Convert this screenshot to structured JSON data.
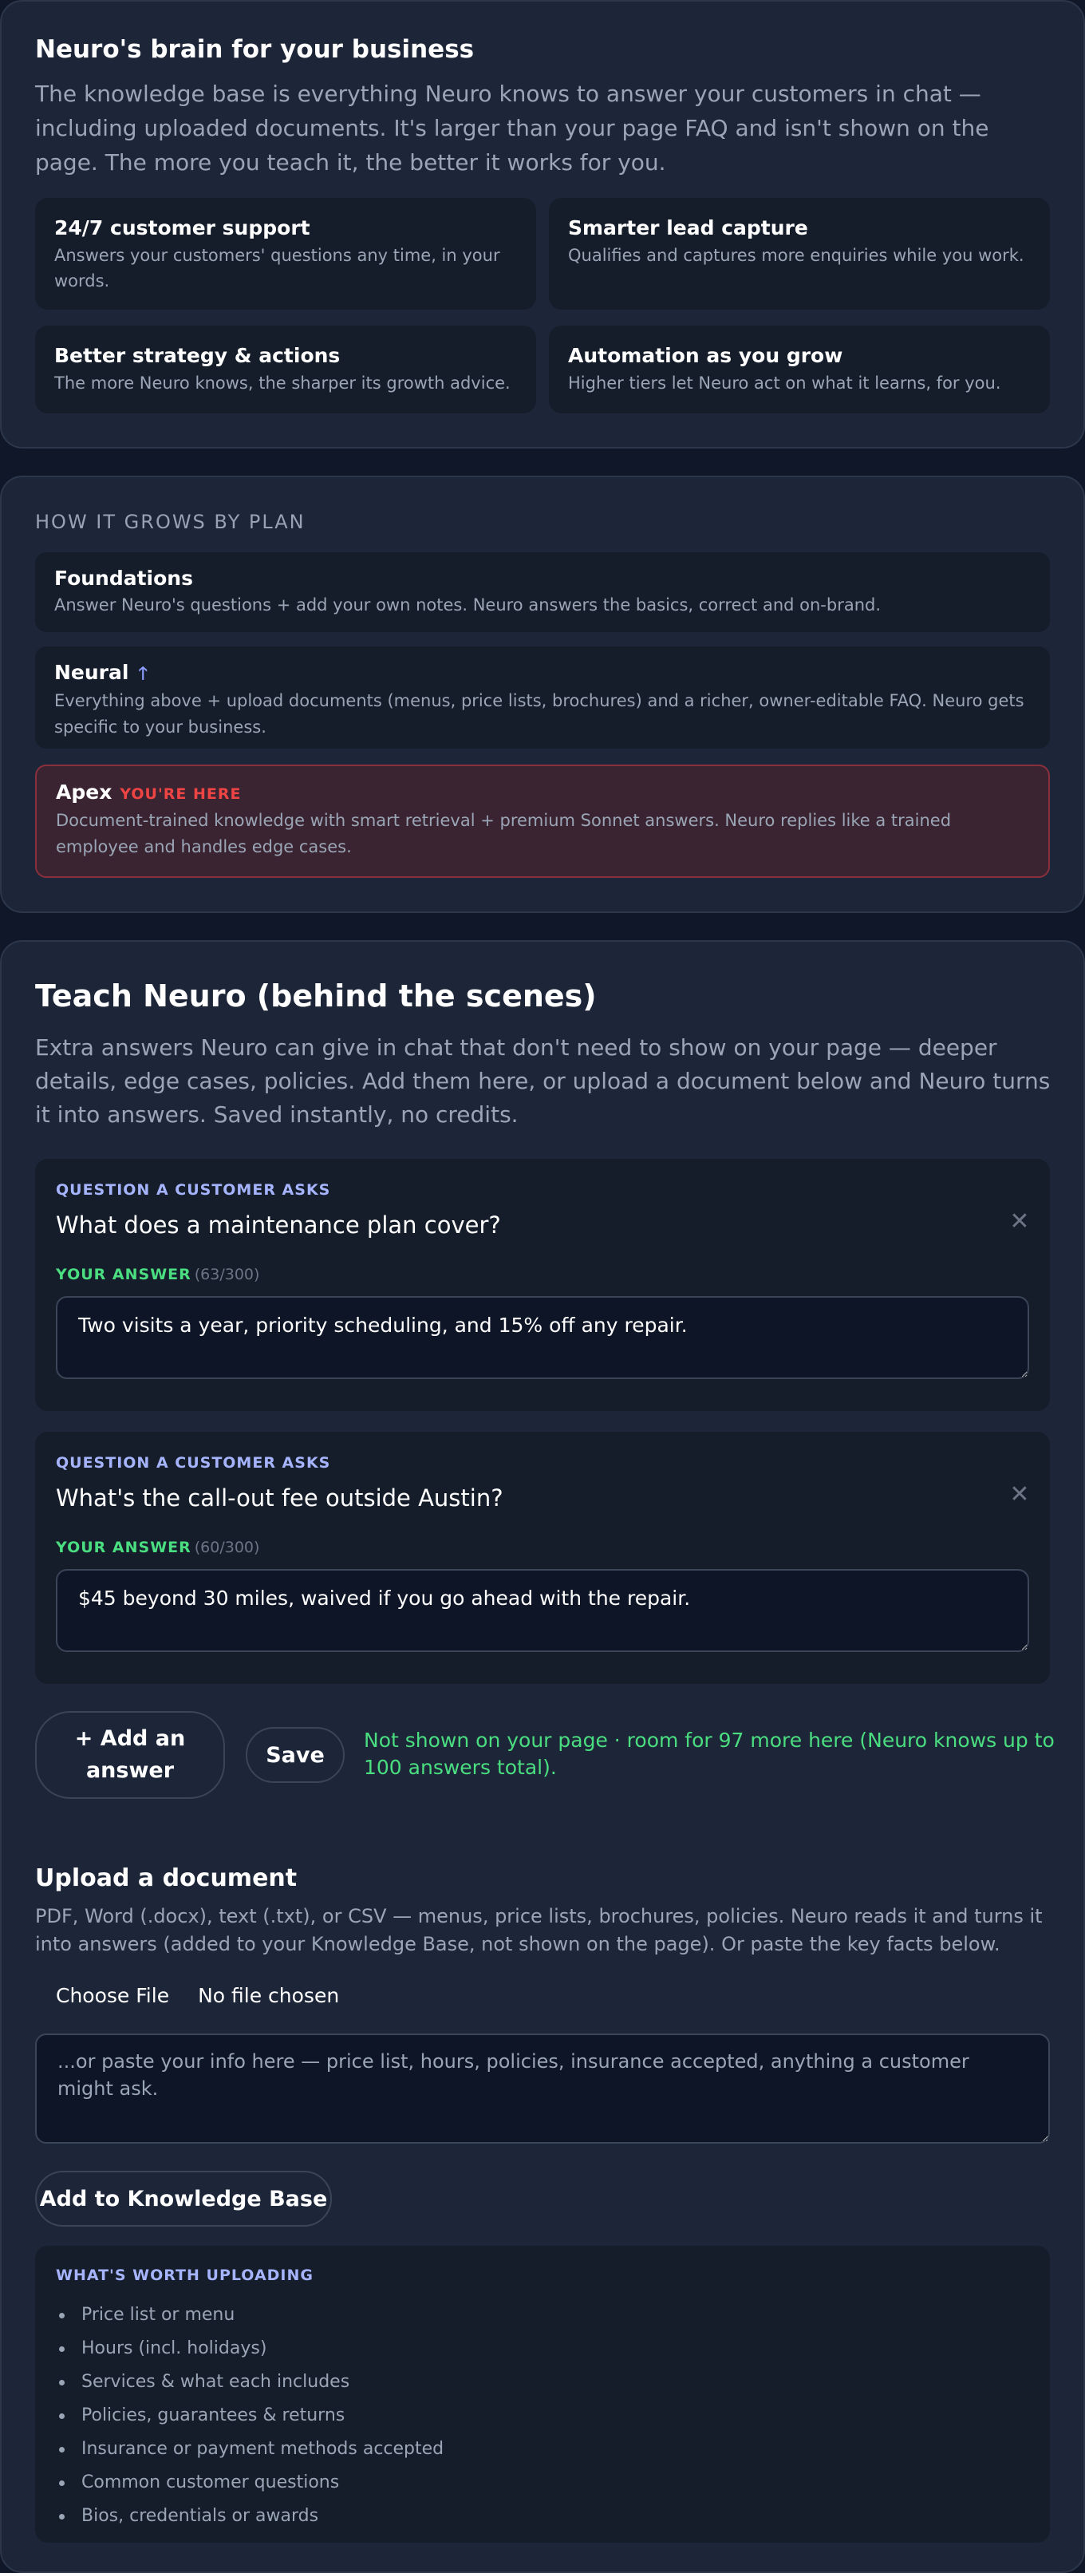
{
  "brain": {
    "title": "Neuro's brain for your business",
    "description": "The knowledge base is everything Neuro knows to answer your customers in chat — including uploaded documents. It's larger than your page FAQ and isn't shown on the page. The more you teach it, the better it works for you.",
    "features": [
      {
        "title": "24/7 customer support",
        "desc": "Answers your customers' questions any time, in your words."
      },
      {
        "title": "Smarter lead capture",
        "desc": "Qualifies and captures more enquiries while you work."
      },
      {
        "title": "Better strategy & actions",
        "desc": "The more Neuro knows, the sharper its growth advice."
      },
      {
        "title": "Automation as you grow",
        "desc": "Higher tiers let Neuro act on what it learns, for you."
      }
    ]
  },
  "grow": {
    "heading": "HOW IT GROWS BY PLAN",
    "plans": [
      {
        "name": "Foundations",
        "desc": "Answer Neuro's questions + add your own notes. Neuro answers the basics, correct and on-brand."
      },
      {
        "name": "Neural",
        "desc": "Everything above + upload documents (menus, price lists, brochures) and a richer, owner-editable FAQ. Neuro gets specific to your business.",
        "icon": "up-arrow-icon"
      },
      {
        "name": "Apex",
        "badge": "YOU'RE HERE",
        "desc": "Document-trained knowledge with smart retrieval + premium Sonnet answers. Neuro replies like a trained employee and handles edge cases."
      }
    ]
  },
  "teach": {
    "title": "Teach Neuro (behind the scenes)",
    "description": "Extra answers Neuro can give in chat that don't need to show on your page — deeper details, edge cases, policies. Add them here, or upload a document below and Neuro turns it into answers. Saved instantly, no credits.",
    "qa_items": [
      {
        "question_label": "QUESTION A CUSTOMER ASKS",
        "question": "What does a maintenance plan cover?",
        "answer_label": "YOUR ANSWER",
        "answer_count": "(63/300)",
        "answer": "Two visits a year, priority scheduling, and 15% off any repair."
      },
      {
        "question_label": "QUESTION A CUSTOMER ASKS",
        "question": "What's the call-out fee outside Austin?",
        "answer_label": "YOUR ANSWER",
        "answer_count": "(60/300)",
        "answer": "$45 beyond 30 miles, waived if you go ahead with the repair."
      }
    ],
    "add_answer_label": "+ Add an answer",
    "save_label": "Save",
    "save_note": "Not shown on your page · room for 97 more here (Neuro knows up to 100 answers total).",
    "upload": {
      "title": "Upload a document",
      "description": "PDF, Word (.docx), text (.txt), or CSV — menus, price lists, brochures, policies. Neuro reads it and turns it into answers (added to your Knowledge Base, not shown on the page). Or paste the key facts below.",
      "choose_file_label": "Choose File",
      "no_file_label": "No file chosen",
      "paste_placeholder": "...or paste your info here — price list, hours, policies, insurance accepted, anything a customer might ask.",
      "add_kb_label": "Add to Knowledge Base"
    },
    "worth": {
      "title": "WHAT'S WORTH UPLOADING",
      "items": [
        "Price list or menu",
        "Hours (incl. holidays)",
        "Services & what each includes",
        "Policies, guarantees & returns",
        "Insurance or payment methods accepted",
        "Common customer questions",
        "Bios, credentials or awards"
      ]
    }
  }
}
